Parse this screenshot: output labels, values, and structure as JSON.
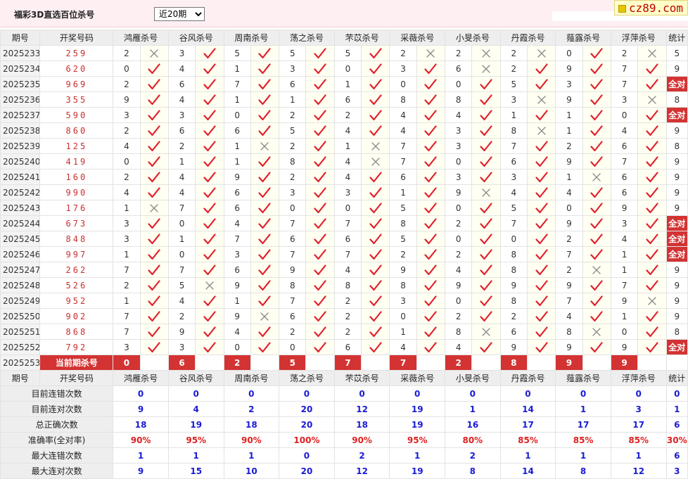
{
  "header": {
    "title": "福彩3D直选百位杀号",
    "period_select": {
      "value": "近20期",
      "options": [
        "近20期"
      ]
    },
    "logo": "cz89.com"
  },
  "columns": {
    "period": "期号",
    "draw": "开奖号码",
    "experts": [
      "鸿雁杀号",
      "谷风杀号",
      "周南杀号",
      "荡之杀号",
      "芣苡杀号",
      "采薇杀号",
      "小旻杀号",
      "丹霞杀号",
      "薤露杀号",
      "浮萍杀号"
    ],
    "stat": "统计"
  },
  "rows": [
    {
      "period": "2025233",
      "draw": "259",
      "picks": [
        [
          "2",
          "x"
        ],
        [
          "3",
          "v"
        ],
        [
          "5",
          "v"
        ],
        [
          "5",
          "v"
        ],
        [
          "5",
          "v"
        ],
        [
          "2",
          "x"
        ],
        [
          "2",
          "x"
        ],
        [
          "2",
          "x"
        ],
        [
          "0",
          "v"
        ],
        [
          "2",
          "x"
        ]
      ],
      "stat": "5"
    },
    {
      "period": "2025234",
      "draw": "620",
      "picks": [
        [
          "0",
          "v"
        ],
        [
          "4",
          "v"
        ],
        [
          "1",
          "v"
        ],
        [
          "3",
          "v"
        ],
        [
          "0",
          "v"
        ],
        [
          "3",
          "v"
        ],
        [
          "6",
          "x"
        ],
        [
          "2",
          "v"
        ],
        [
          "9",
          "v"
        ],
        [
          "7",
          "v"
        ]
      ],
      "stat": "9"
    },
    {
      "period": "2025235",
      "draw": "969",
      "picks": [
        [
          "2",
          "v"
        ],
        [
          "6",
          "v"
        ],
        [
          "7",
          "v"
        ],
        [
          "6",
          "v"
        ],
        [
          "1",
          "v"
        ],
        [
          "0",
          "v"
        ],
        [
          "0",
          "v"
        ],
        [
          "5",
          "v"
        ],
        [
          "3",
          "v"
        ],
        [
          "7",
          "v"
        ]
      ],
      "stat": "全对"
    },
    {
      "period": "2025236",
      "draw": "355",
      "picks": [
        [
          "9",
          "v"
        ],
        [
          "4",
          "v"
        ],
        [
          "1",
          "v"
        ],
        [
          "1",
          "v"
        ],
        [
          "6",
          "v"
        ],
        [
          "8",
          "v"
        ],
        [
          "8",
          "v"
        ],
        [
          "3",
          "x"
        ],
        [
          "9",
          "v"
        ],
        [
          "3",
          "x"
        ]
      ],
      "stat": "8"
    },
    {
      "period": "2025237",
      "draw": "590",
      "picks": [
        [
          "3",
          "v"
        ],
        [
          "3",
          "v"
        ],
        [
          "0",
          "v"
        ],
        [
          "2",
          "v"
        ],
        [
          "2",
          "v"
        ],
        [
          "4",
          "v"
        ],
        [
          "4",
          "v"
        ],
        [
          "1",
          "v"
        ],
        [
          "1",
          "v"
        ],
        [
          "0",
          "v"
        ]
      ],
      "stat": "全对"
    },
    {
      "period": "2025238",
      "draw": "860",
      "picks": [
        [
          "2",
          "v"
        ],
        [
          "6",
          "v"
        ],
        [
          "6",
          "v"
        ],
        [
          "5",
          "v"
        ],
        [
          "4",
          "v"
        ],
        [
          "4",
          "v"
        ],
        [
          "3",
          "v"
        ],
        [
          "8",
          "x"
        ],
        [
          "1",
          "v"
        ],
        [
          "4",
          "v"
        ]
      ],
      "stat": "9"
    },
    {
      "period": "2025239",
      "draw": "125",
      "picks": [
        [
          "4",
          "v"
        ],
        [
          "2",
          "v"
        ],
        [
          "1",
          "x"
        ],
        [
          "2",
          "v"
        ],
        [
          "1",
          "x"
        ],
        [
          "7",
          "v"
        ],
        [
          "3",
          "v"
        ],
        [
          "7",
          "v"
        ],
        [
          "2",
          "v"
        ],
        [
          "6",
          "v"
        ]
      ],
      "stat": "8"
    },
    {
      "period": "2025240",
      "draw": "419",
      "picks": [
        [
          "0",
          "v"
        ],
        [
          "1",
          "v"
        ],
        [
          "1",
          "v"
        ],
        [
          "8",
          "v"
        ],
        [
          "4",
          "x"
        ],
        [
          "7",
          "v"
        ],
        [
          "0",
          "v"
        ],
        [
          "6",
          "v"
        ],
        [
          "9",
          "v"
        ],
        [
          "7",
          "v"
        ]
      ],
      "stat": "9"
    },
    {
      "period": "2025241",
      "draw": "160",
      "picks": [
        [
          "2",
          "v"
        ],
        [
          "4",
          "v"
        ],
        [
          "9",
          "v"
        ],
        [
          "2",
          "v"
        ],
        [
          "4",
          "v"
        ],
        [
          "6",
          "v"
        ],
        [
          "3",
          "v"
        ],
        [
          "3",
          "v"
        ],
        [
          "1",
          "x"
        ],
        [
          "6",
          "v"
        ]
      ],
      "stat": "9"
    },
    {
      "period": "2025242",
      "draw": "990",
      "picks": [
        [
          "4",
          "v"
        ],
        [
          "4",
          "v"
        ],
        [
          "6",
          "v"
        ],
        [
          "3",
          "v"
        ],
        [
          "3",
          "v"
        ],
        [
          "1",
          "v"
        ],
        [
          "9",
          "x"
        ],
        [
          "4",
          "v"
        ],
        [
          "4",
          "v"
        ],
        [
          "6",
          "v"
        ]
      ],
      "stat": "9"
    },
    {
      "period": "2025243",
      "draw": "176",
      "picks": [
        [
          "1",
          "x"
        ],
        [
          "7",
          "v"
        ],
        [
          "6",
          "v"
        ],
        [
          "0",
          "v"
        ],
        [
          "0",
          "v"
        ],
        [
          "5",
          "v"
        ],
        [
          "0",
          "v"
        ],
        [
          "5",
          "v"
        ],
        [
          "0",
          "v"
        ],
        [
          "9",
          "v"
        ]
      ],
      "stat": "9"
    },
    {
      "period": "2025244",
      "draw": "673",
      "picks": [
        [
          "3",
          "v"
        ],
        [
          "0",
          "v"
        ],
        [
          "4",
          "v"
        ],
        [
          "7",
          "v"
        ],
        [
          "7",
          "v"
        ],
        [
          "8",
          "v"
        ],
        [
          "2",
          "v"
        ],
        [
          "7",
          "v"
        ],
        [
          "9",
          "v"
        ],
        [
          "3",
          "v"
        ]
      ],
      "stat": "全对"
    },
    {
      "period": "2025245",
      "draw": "848",
      "picks": [
        [
          "3",
          "v"
        ],
        [
          "1",
          "v"
        ],
        [
          "7",
          "v"
        ],
        [
          "6",
          "v"
        ],
        [
          "6",
          "v"
        ],
        [
          "5",
          "v"
        ],
        [
          "0",
          "v"
        ],
        [
          "0",
          "v"
        ],
        [
          "2",
          "v"
        ],
        [
          "4",
          "v"
        ]
      ],
      "stat": "全对"
    },
    {
      "period": "2025246",
      "draw": "997",
      "picks": [
        [
          "1",
          "v"
        ],
        [
          "0",
          "v"
        ],
        [
          "3",
          "v"
        ],
        [
          "7",
          "v"
        ],
        [
          "7",
          "v"
        ],
        [
          "2",
          "v"
        ],
        [
          "2",
          "v"
        ],
        [
          "8",
          "v"
        ],
        [
          "7",
          "v"
        ],
        [
          "1",
          "v"
        ]
      ],
      "stat": "全对"
    },
    {
      "period": "2025247",
      "draw": "262",
      "picks": [
        [
          "7",
          "v"
        ],
        [
          "7",
          "v"
        ],
        [
          "6",
          "v"
        ],
        [
          "9",
          "v"
        ],
        [
          "4",
          "v"
        ],
        [
          "9",
          "v"
        ],
        [
          "4",
          "v"
        ],
        [
          "8",
          "v"
        ],
        [
          "2",
          "x"
        ],
        [
          "1",
          "v"
        ]
      ],
      "stat": "9"
    },
    {
      "period": "2025248",
      "draw": "526",
      "picks": [
        [
          "2",
          "v"
        ],
        [
          "5",
          "x"
        ],
        [
          "9",
          "v"
        ],
        [
          "8",
          "v"
        ],
        [
          "8",
          "v"
        ],
        [
          "8",
          "v"
        ],
        [
          "9",
          "v"
        ],
        [
          "9",
          "v"
        ],
        [
          "9",
          "v"
        ],
        [
          "7",
          "v"
        ]
      ],
      "stat": "9"
    },
    {
      "period": "2025249",
      "draw": "952",
      "picks": [
        [
          "1",
          "v"
        ],
        [
          "4",
          "v"
        ],
        [
          "1",
          "v"
        ],
        [
          "7",
          "v"
        ],
        [
          "2",
          "v"
        ],
        [
          "3",
          "v"
        ],
        [
          "0",
          "v"
        ],
        [
          "8",
          "v"
        ],
        [
          "7",
          "v"
        ],
        [
          "9",
          "x"
        ]
      ],
      "stat": "9"
    },
    {
      "period": "2025250",
      "draw": "902",
      "picks": [
        [
          "7",
          "v"
        ],
        [
          "2",
          "v"
        ],
        [
          "9",
          "x"
        ],
        [
          "6",
          "v"
        ],
        [
          "2",
          "v"
        ],
        [
          "0",
          "v"
        ],
        [
          "2",
          "v"
        ],
        [
          "2",
          "v"
        ],
        [
          "4",
          "v"
        ],
        [
          "1",
          "v"
        ]
      ],
      "stat": "9"
    },
    {
      "period": "2025251",
      "draw": "868",
      "picks": [
        [
          "7",
          "v"
        ],
        [
          "9",
          "v"
        ],
        [
          "4",
          "v"
        ],
        [
          "2",
          "v"
        ],
        [
          "2",
          "v"
        ],
        [
          "1",
          "v"
        ],
        [
          "8",
          "x"
        ],
        [
          "6",
          "v"
        ],
        [
          "8",
          "x"
        ],
        [
          "0",
          "v"
        ]
      ],
      "stat": "8"
    },
    {
      "period": "2025252",
      "draw": "792",
      "picks": [
        [
          "3",
          "v"
        ],
        [
          "3",
          "v"
        ],
        [
          "0",
          "v"
        ],
        [
          "0",
          "v"
        ],
        [
          "6",
          "v"
        ],
        [
          "4",
          "v"
        ],
        [
          "4",
          "v"
        ],
        [
          "9",
          "v"
        ],
        [
          "9",
          "v"
        ],
        [
          "9",
          "v"
        ]
      ],
      "stat": "全对"
    }
  ],
  "current": {
    "period": "2025253",
    "label": "当前期杀号",
    "kills": [
      "0",
      "6",
      "2",
      "5",
      "7",
      "7",
      "2",
      "8",
      "9",
      "9"
    ]
  },
  "stats": [
    {
      "label": "目前连错次数",
      "values": [
        "0",
        "0",
        "0",
        "0",
        "0",
        "0",
        "0",
        "0",
        "0",
        "0"
      ],
      "total": "0",
      "red": false
    },
    {
      "label": "目前连对次数",
      "values": [
        "9",
        "4",
        "2",
        "20",
        "12",
        "19",
        "1",
        "14",
        "1",
        "3"
      ],
      "total": "1",
      "red": false
    },
    {
      "label": "总正确次数",
      "values": [
        "18",
        "19",
        "18",
        "20",
        "18",
        "19",
        "16",
        "17",
        "17",
        "17"
      ],
      "total": "6",
      "red": false
    },
    {
      "label": "准确率(全对率)",
      "values": [
        "90%",
        "95%",
        "90%",
        "100%",
        "90%",
        "95%",
        "80%",
        "85%",
        "85%",
        "85%"
      ],
      "total": "30%",
      "red": true
    },
    {
      "label": "最大连错次数",
      "values": [
        "1",
        "1",
        "1",
        "0",
        "2",
        "1",
        "2",
        "1",
        "1",
        "1"
      ],
      "total": "6",
      "red": false
    },
    {
      "label": "最大连对次数",
      "values": [
        "9",
        "15",
        "10",
        "20",
        "12",
        "19",
        "8",
        "14",
        "8",
        "12"
      ],
      "total": "3",
      "red": false
    }
  ],
  "colors": {
    "accent_red": "#d33333",
    "check_red": "#e0202a",
    "cross_gray": "#8a8a8a",
    "stat_blue": "#1a1ad6",
    "header_pink": "#fdeff2"
  }
}
